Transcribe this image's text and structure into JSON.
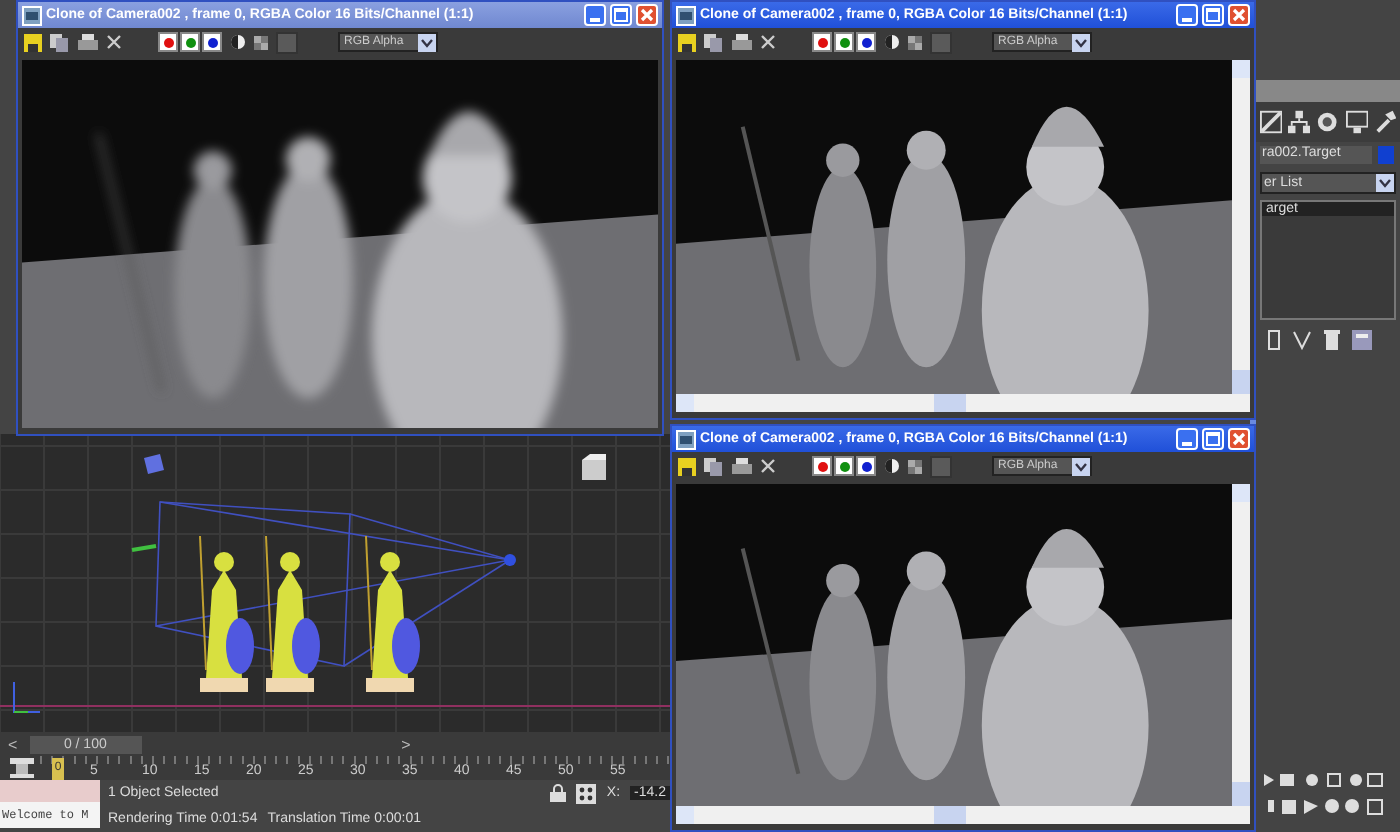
{
  "render_windows": [
    {
      "title": "Clone of Camera002 , frame 0, RGBA Color 16 Bits/Channel (1:1)",
      "channel_menu": "RGB Alpha",
      "blurred": true,
      "scrollbars": false,
      "active": false
    },
    {
      "title": "Clone of Camera002 , frame 0, RGBA Color 16 Bits/Channel (1:1)",
      "channel_menu": "RGB Alpha",
      "blurred": false,
      "scrollbars": true,
      "active": true
    },
    {
      "title": "Clone of Camera002 , frame 0, RGBA Color 16 Bits/Channel (1:1)",
      "channel_menu": "RGB Alpha",
      "blurred": false,
      "scrollbars": true,
      "active": true
    }
  ],
  "channel_buttons": [
    {
      "color": "#e01010",
      "on": true
    },
    {
      "color": "#109010",
      "on": true
    },
    {
      "color": "#1020d0",
      "on": true
    }
  ],
  "command_panel": {
    "object_name": "ra002.Target",
    "modifier_list": "er List",
    "stack": [
      {
        "label": "arget",
        "selected": true
      }
    ]
  },
  "time_slider": {
    "label": "0 / 100",
    "level": 0,
    "prev": "<",
    "next": ">"
  },
  "ruler": {
    "current": "0",
    "labels": [
      "5",
      "10",
      "15",
      "20",
      "25",
      "30",
      "35",
      "40",
      "45",
      "50",
      "55"
    ]
  },
  "status_bar": {
    "prompt": "Welcome to M",
    "selection": "1 Object Selected",
    "rendering_time": "Rendering Time  0:01:54",
    "translation_time": "Translation Time  0:00:01",
    "coord_label": "X:",
    "coord_value": "-14.2"
  }
}
